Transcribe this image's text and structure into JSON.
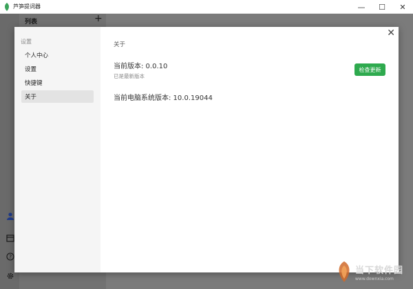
{
  "window": {
    "title": "芦笋提词器",
    "controls": {
      "minimize": "—",
      "maximize": "☐",
      "close": "✕"
    }
  },
  "background_app": {
    "list_title": "列表",
    "add_symbol": "+",
    "icons": [
      "user-icon",
      "calendar-icon",
      "help-icon",
      "settings-icon"
    ]
  },
  "modal": {
    "sidebar": {
      "heading": "设置",
      "items": [
        {
          "label": "个人中心",
          "active": false
        },
        {
          "label": "设置",
          "active": false
        },
        {
          "label": "快捷键",
          "active": false
        },
        {
          "label": "关于",
          "active": true
        }
      ]
    },
    "content": {
      "section_title": "关于",
      "current_version": "当前版本: 0.0.10",
      "latest_note": "已是最新版本",
      "check_update_label": "检查更新",
      "os_version": "当前电脑系统版本: 10.0.19044"
    },
    "close_symbol": "✕"
  },
  "watermark": {
    "text": "当下软件园",
    "url": "www.downxia.com"
  },
  "colors": {
    "accent_green": "#2eaa4e",
    "overlay": "#7a7a7a",
    "sidebar_bg": "#f5f5f5",
    "active_item_bg": "#e3e3e3"
  }
}
